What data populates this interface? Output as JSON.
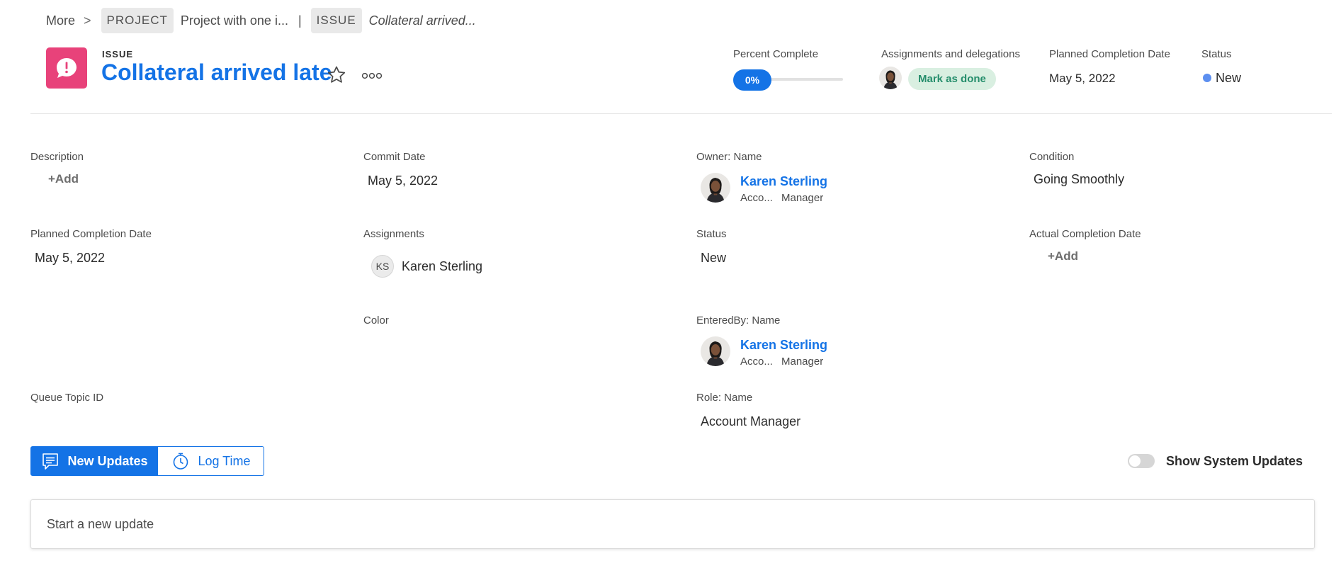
{
  "breadcrumb": {
    "more": "More",
    "chevron": ">",
    "project_tag": "PROJECT",
    "project_name": "Project with one i...",
    "separator": "|",
    "issue_tag": "ISSUE",
    "issue_name": "Collateral arrived..."
  },
  "header": {
    "type_label": "ISSUE",
    "title": "Collateral arrived late",
    "icon": "issue-exclamation-icon",
    "icon_color": "#e8427a",
    "percent_complete": {
      "label": "Percent Complete",
      "value": "0%",
      "fraction": 0.0
    },
    "assignments": {
      "label": "Assignments and delegations",
      "mark_done": "Mark as done"
    },
    "planned_completion": {
      "label": "Planned Completion Date",
      "value": "May 5, 2022"
    },
    "status": {
      "label": "Status",
      "value": "New",
      "dot_color": "#5c8ff0"
    }
  },
  "fields": {
    "description": {
      "label": "Description",
      "add": "+Add"
    },
    "commit_date": {
      "label": "Commit Date",
      "value": "May 5, 2022"
    },
    "owner": {
      "label": "Owner: Name",
      "name": "Karen Sterling",
      "role_short": "Acco...",
      "role_title": "Manager"
    },
    "condition": {
      "label": "Condition",
      "value": "Going Smoothly"
    },
    "planned_completion": {
      "label": "Planned Completion Date",
      "value": "May 5, 2022"
    },
    "assignments": {
      "label": "Assignments",
      "initials": "KS",
      "name": "Karen Sterling"
    },
    "status": {
      "label": "Status",
      "value": "New"
    },
    "actual_completion": {
      "label": "Actual Completion Date",
      "add": "+Add"
    },
    "color": {
      "label": "Color"
    },
    "entered_by": {
      "label": "EnteredBy: Name",
      "name": "Karen Sterling",
      "role_short": "Acco...",
      "role_title": "Manager"
    },
    "queue_topic": {
      "label": "Queue Topic ID"
    },
    "role": {
      "label": "Role: Name",
      "value": "Account Manager"
    }
  },
  "updates": {
    "new_updates": "New Updates",
    "log_time": "Log Time",
    "show_system_updates": "Show System Updates",
    "show_system_updates_on": false,
    "placeholder": "Start a new update"
  },
  "colors": {
    "accent": "#1473e6",
    "success_text": "#268e6c",
    "success_bg": "#d9efe1"
  }
}
